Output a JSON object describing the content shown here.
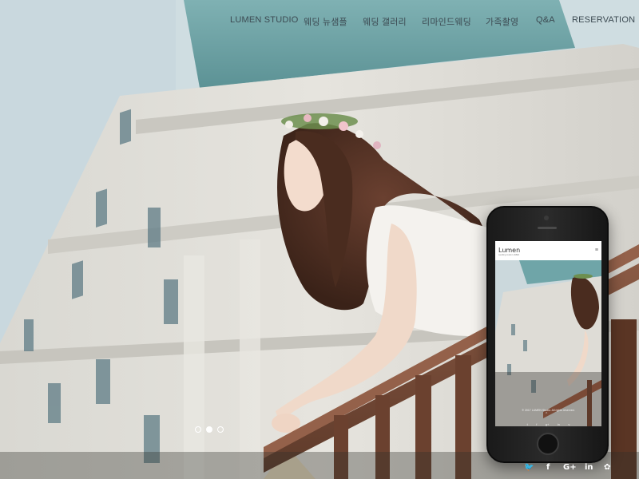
{
  "nav": {
    "items": [
      {
        "label": "LUMEN STUDIO",
        "name": "nav-lumen-studio"
      },
      {
        "label": "웨딩 뉴샘플",
        "name": "nav-wedding-new-sample"
      },
      {
        "label": "웨딩 갤러리",
        "name": "nav-wedding-gallery"
      },
      {
        "label": "리마인드웨딩",
        "name": "nav-remind-wedding"
      },
      {
        "label": "가족촬영",
        "name": "nav-family-photo"
      },
      {
        "label": "Q&A",
        "name": "nav-qna"
      },
      {
        "label": "RESERVATION",
        "name": "nav-reservation"
      }
    ]
  },
  "slider": {
    "dot_count": 3,
    "active_index": 1
  },
  "mobile": {
    "logo": "Lumen",
    "tagline": "wedding studio LUMEN",
    "menu_icon": "hamburger-icon",
    "footer_copyright": "© 2017 LUMEN Studio. All rights reserved.",
    "footer_icon": "chevron-up-icon",
    "social": [
      "t",
      "f",
      "g+",
      "in",
      "v"
    ]
  },
  "social": {
    "icons": [
      {
        "glyph": "🐦",
        "name": "twitter-icon"
      },
      {
        "glyph": "f",
        "name": "facebook-icon"
      },
      {
        "glyph": "G+",
        "name": "google-plus-icon"
      },
      {
        "glyph": "in",
        "name": "linkedin-icon"
      },
      {
        "glyph": "✿",
        "name": "vine-icon"
      }
    ]
  },
  "colors": {
    "nav_text": "#3c4a52",
    "building_roof": "#6fa5a8",
    "railing": "#7a4a36",
    "bottom_bar": "#32302c"
  }
}
